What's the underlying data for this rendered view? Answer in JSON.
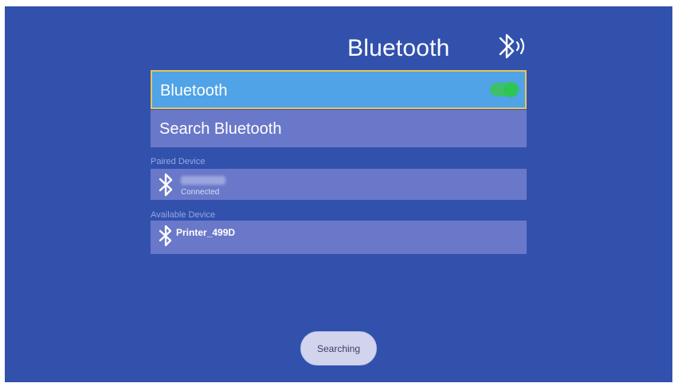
{
  "header": {
    "title": "Bluetooth",
    "icon": "bluetooth-audio-icon"
  },
  "settings": {
    "bluetooth_toggle": {
      "label": "Bluetooth",
      "state": "on",
      "color_on": "#2ec653"
    },
    "search": {
      "label": "Search Bluetooth"
    }
  },
  "paired": {
    "section_label": "Paired Device",
    "devices": [
      {
        "name_blurred": true,
        "status": "Connected",
        "icon": "bluetooth-icon"
      }
    ]
  },
  "available": {
    "section_label": "Available Device",
    "devices": [
      {
        "name": "Printer_499D",
        "icon": "bluetooth-icon"
      }
    ]
  },
  "footer": {
    "button_label": "Searching"
  },
  "colors": {
    "background": "#3151ad",
    "selected_row": "#4fa3e6",
    "row": "#6a78c9",
    "focus_border": "#e9c35a"
  }
}
